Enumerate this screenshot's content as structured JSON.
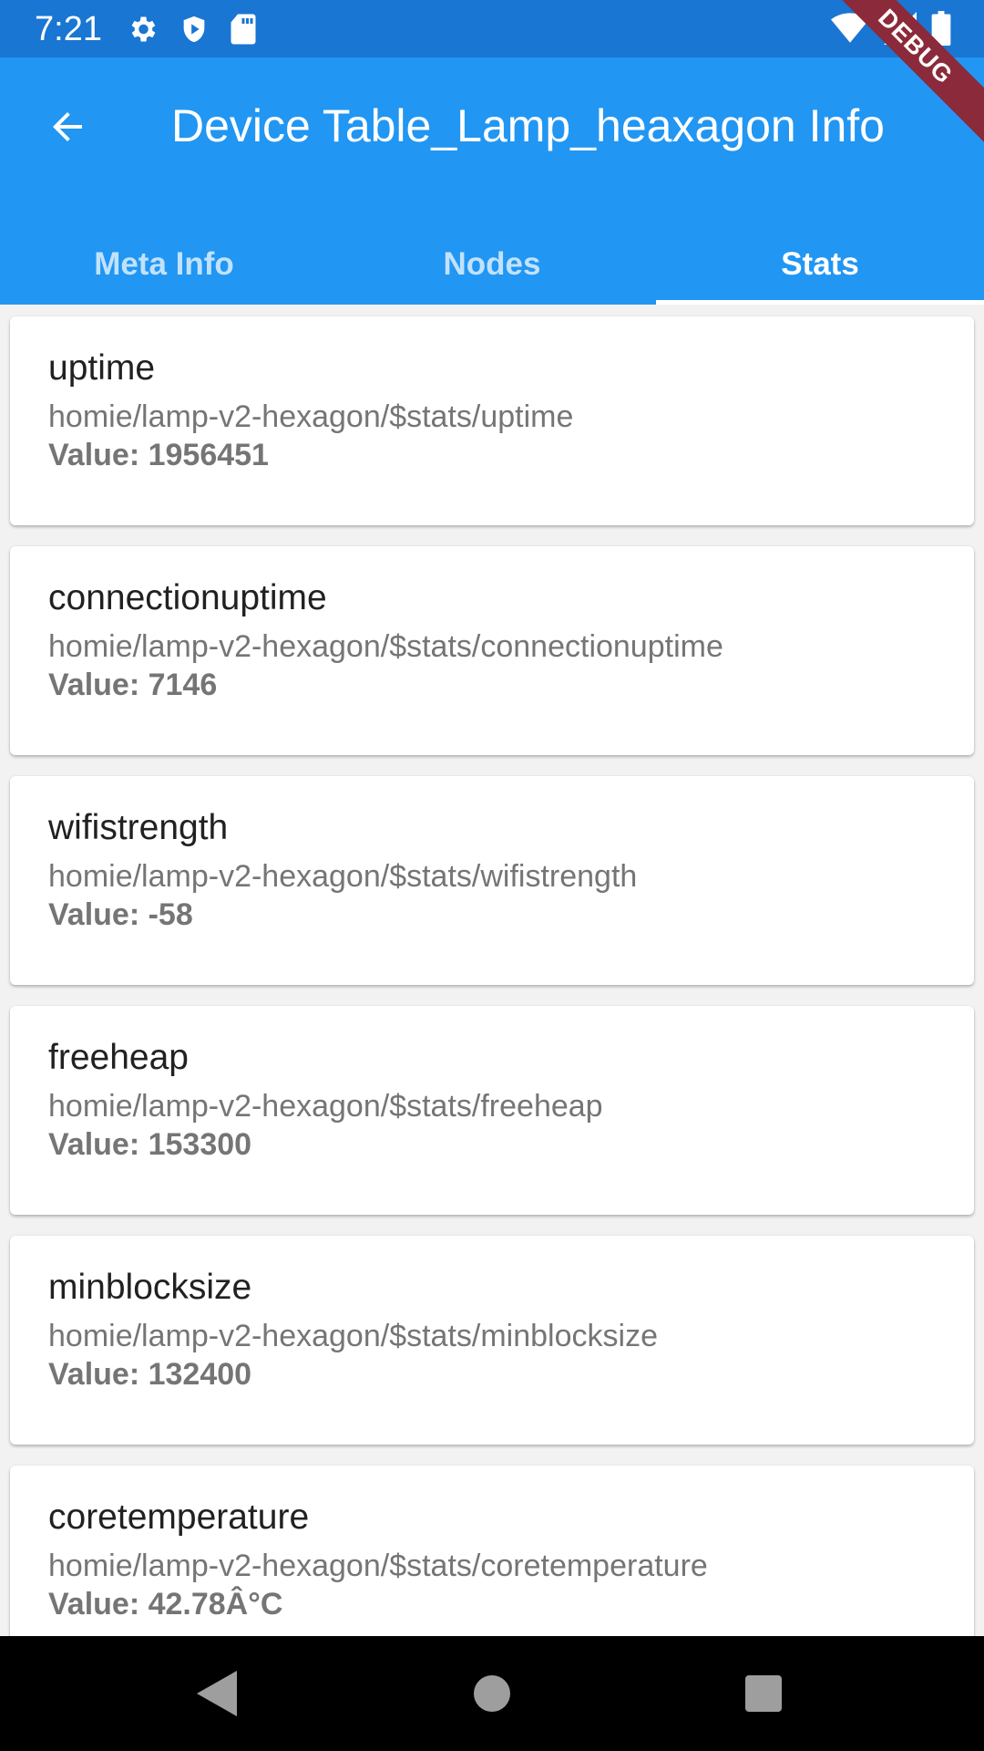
{
  "status_bar": {
    "time": "7:21",
    "left_icons": [
      "gear-icon",
      "shield-icon",
      "sd-card-icon"
    ],
    "right_icons": [
      "wifi-icon",
      "cell-signal-icon",
      "battery-icon"
    ]
  },
  "app_bar": {
    "title": "Device Table_Lamp_heaxagon Info",
    "back_icon": "arrow-back-icon",
    "color": "#2196f3"
  },
  "debug_banner": "DEBUG",
  "tabs": [
    {
      "label": "Meta Info",
      "active": false
    },
    {
      "label": "Nodes",
      "active": false
    },
    {
      "label": "Stats",
      "active": true
    }
  ],
  "stats": [
    {
      "name": "uptime",
      "topic": "homie/lamp-v2-hexagon/$stats/uptime",
      "value": "Value: 1956451"
    },
    {
      "name": "connectionuptime",
      "topic": "homie/lamp-v2-hexagon/$stats/connectionuptime",
      "value": "Value: 7146"
    },
    {
      "name": "wifistrength",
      "topic": "homie/lamp-v2-hexagon/$stats/wifistrength",
      "value": "Value: -58"
    },
    {
      "name": "freeheap",
      "topic": "homie/lamp-v2-hexagon/$stats/freeheap",
      "value": "Value: 153300"
    },
    {
      "name": "minblocksize",
      "topic": "homie/lamp-v2-hexagon/$stats/minblocksize",
      "value": "Value: 132400"
    },
    {
      "name": "coretemperature",
      "topic": "homie/lamp-v2-hexagon/$stats/coretemperature",
      "value": "Value: 42.78Â°C"
    }
  ],
  "nav_bar": [
    "back-triangle-icon",
    "home-circle-icon",
    "recents-square-icon"
  ]
}
